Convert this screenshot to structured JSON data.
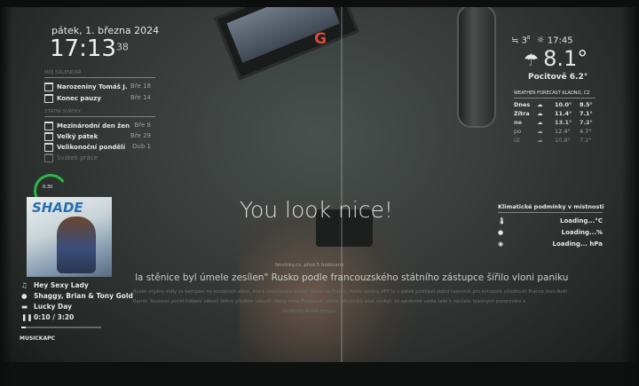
{
  "clock": {
    "date": "pátek, 1. března 2024",
    "time": "17:13",
    "seconds": "38"
  },
  "calendar": {
    "header": "MŮJ KALENDÁŘ",
    "events": [
      {
        "name": "Narozeniny Tomáš J.",
        "when": "Bře 18"
      },
      {
        "name": "Konec pauzy",
        "when": "Bře 14"
      }
    ]
  },
  "holidays": {
    "header": "STÁTNÍ SVÁTKY",
    "events": [
      {
        "name": "Mezinárodní den žen",
        "when": "Bře 8"
      },
      {
        "name": "Velký pátek",
        "when": "Bře 29"
      },
      {
        "name": "Velikonoční pondělí",
        "when": "Dub 1"
      },
      {
        "name": "Svátek práce",
        "when": ""
      }
    ]
  },
  "weather": {
    "wind": "3",
    "wind_unit": "B",
    "sunset": "17:45",
    "temp": "8.1°",
    "feels": "Pocitově 6.2°",
    "forecast_header": "WEATHER FORECAST KLADNO, CZ",
    "forecast": [
      {
        "day": "Dnes",
        "max": "10.0°",
        "min": "8.5°"
      },
      {
        "day": "Zítra",
        "max": "11.4°",
        "min": "7.1°"
      },
      {
        "day": "ne",
        "max": "13.1°",
        "min": "7.2°"
      },
      {
        "day": "po",
        "max": "12.4°",
        "min": "4.7°"
      },
      {
        "day": "út",
        "max": "10.8°",
        "min": "7.2°"
      }
    ]
  },
  "indoor": {
    "header": "Klimatické podmínky v místnosti",
    "temp": "Loading...°C",
    "humidity": "Loading...%",
    "pressure": "Loading... hPa"
  },
  "compliment": "You look nice!",
  "news": {
    "source": "Novinky.cz, před 5 hodinami",
    "headline": "la stěnice byl úmele zesílen\" Rusko podle francouzského státního zástupce šířilo vloni paniku",
    "body1": "Ruské orgány stály za kampaní na sociálních sítích, která zveličovala výskyt štěnic ve Francii. Podle zprávy AFP to v pátek prohlásil státní tajemník pro evropské záležitosti France Jean-Noël",
    "body2": "Barrot. Rostoucí počet hlášení nálezů štěnic předtím vzbudil obavy mezi Francouzi, podle odborníků však výskyt, že epidemie vedla také k nárůstu falešných pozorování a",
    "body3": "ostatních druhů hmyzu."
  },
  "music": {
    "album_art_text": "SHADE",
    "title": "Hey Sexy Lady",
    "artist": "Shaggy, Brian & Tony Gold",
    "album": "Lucky Day",
    "position": "0:10",
    "duration": "3:20",
    "progress": 0.05,
    "footer": "MUSICKAPC"
  },
  "timer_label": "0:30"
}
